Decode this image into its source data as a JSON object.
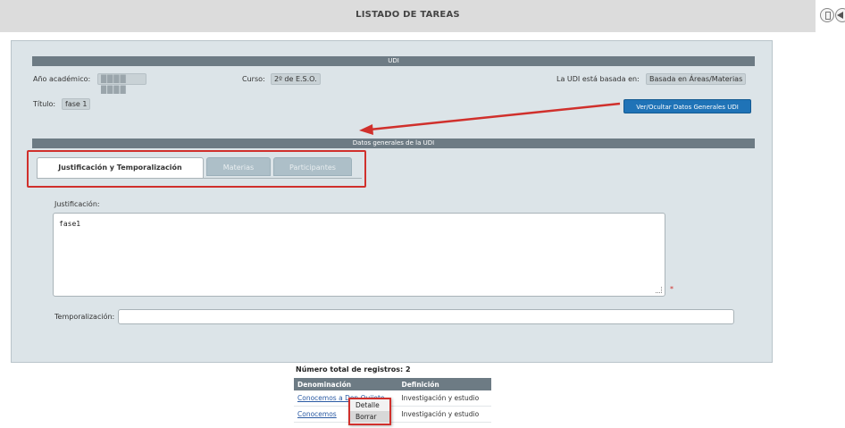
{
  "header": {
    "title": "LISTADO DE TAREAS"
  },
  "udi": {
    "section_title": "UDI",
    "anio_label": "Año académico:",
    "anio_value": "████ ████",
    "curso_label": "Curso:",
    "curso_value": "2º de E.S.O.",
    "basada_label": "La UDI está basada en:",
    "basada_value": "Basada en Áreas/Materias",
    "titulo_label": "Título:",
    "titulo_value": "fase 1",
    "toggle_button": "Ver/Ocultar Datos Generales UDI"
  },
  "datos": {
    "section_title": "Datos generales de la UDI",
    "tabs": [
      {
        "label": "Justificación y Temporalización"
      },
      {
        "label": "Materias"
      },
      {
        "label": "Participantes"
      }
    ],
    "justificacion_label": "Justificación:",
    "justificacion_value": "fase1",
    "required_mark": "*",
    "temporalizacion_label": "Temporalización:",
    "temporalizacion_value": ""
  },
  "list": {
    "total_label": "Número total de registros: 2",
    "columns": [
      "Denominación",
      "Definición"
    ],
    "rows": [
      {
        "denominacion": "Conocemos a Don Quijote",
        "definicion": "Investigación y estudio"
      },
      {
        "denominacion": "Conocemos",
        "definicion": "Investigación y estudio"
      }
    ]
  },
  "context_menu": {
    "items": [
      "Detalle",
      "Borrar"
    ],
    "selected": "Borrar"
  },
  "colors": {
    "accent_red": "#d0302c",
    "bar_gray": "#6d7b84",
    "button_blue": "#1f73b7",
    "panel_bg": "#dce4e8"
  }
}
